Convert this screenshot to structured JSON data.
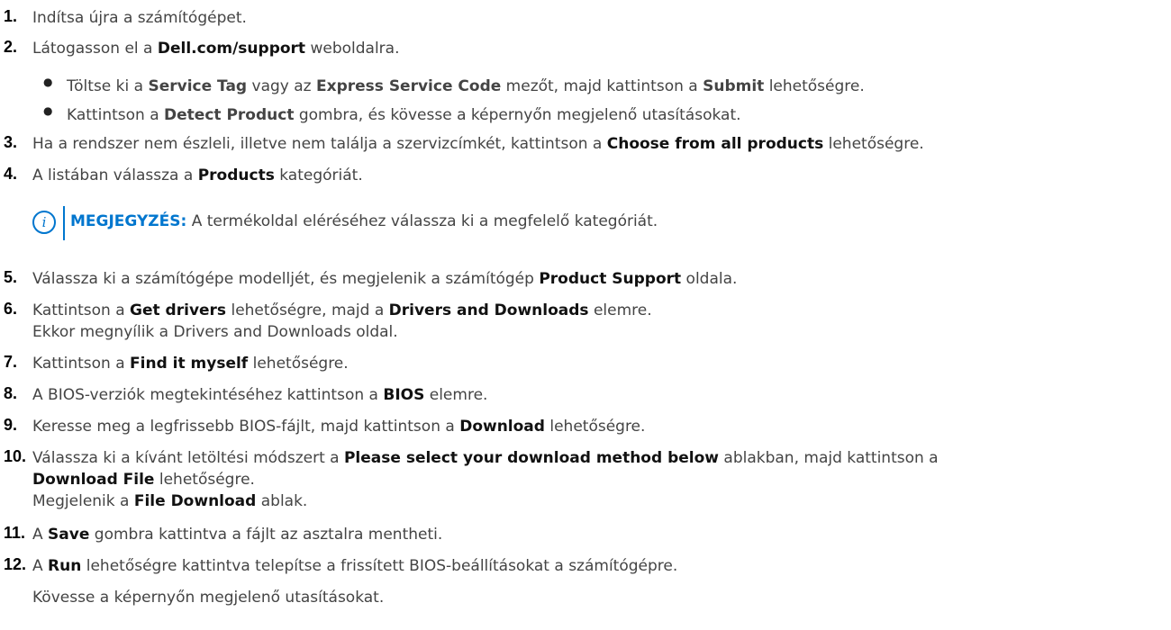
{
  "steps": [
    {
      "n": "1.",
      "parts": [
        [
          "t",
          "Indítsa újra a számítógépet."
        ]
      ]
    },
    {
      "n": "2.",
      "parts": [
        [
          "t",
          "Látogasson el a "
        ],
        [
          "b",
          "Dell.com/support"
        ],
        [
          "t",
          " weboldalra."
        ]
      ],
      "bullets": [
        [
          [
            "t",
            "Töltse ki a "
          ],
          [
            "b",
            "Service Tag"
          ],
          [
            "t",
            " vagy az "
          ],
          [
            "b",
            "Express Service Code"
          ],
          [
            "t",
            " mezőt, majd kattintson a "
          ],
          [
            "b",
            "Submit"
          ],
          [
            "t",
            " lehetőségre."
          ]
        ],
        [
          [
            "t",
            "Kattintson a "
          ],
          [
            "b",
            "Detect Product"
          ],
          [
            "t",
            " gombra, és kövesse a képernyőn megjelenő utasításokat."
          ]
        ]
      ]
    },
    {
      "n": "3.",
      "parts": [
        [
          "t",
          "Ha a rendszer nem észleli, illetve nem találja a szervizcímkét, kattintson a "
        ],
        [
          "b",
          "Choose from all products"
        ],
        [
          "t",
          " lehetőségre."
        ]
      ]
    },
    {
      "n": "4.",
      "parts": [
        [
          "t",
          "A listában válassza a "
        ],
        [
          "b",
          "Products"
        ],
        [
          "t",
          " kategóriát."
        ]
      ]
    },
    {
      "n": "5.",
      "parts": [
        [
          "t",
          "Válassza ki a számítógépe modelljét, és megjelenik a számítógép "
        ],
        [
          "b",
          "Product Support"
        ],
        [
          "t",
          " oldala."
        ]
      ]
    },
    {
      "n": "6.",
      "parts": [
        [
          "t",
          "Kattintson a "
        ],
        [
          "b",
          "Get drivers"
        ],
        [
          "t",
          " lehetőségre, majd a "
        ],
        [
          "b",
          "Drivers and Downloads"
        ],
        [
          "t",
          " elemre."
        ]
      ],
      "extra": [
        [
          [
            "t",
            "Ekkor megnyílik a Drivers and Downloads oldal."
          ]
        ]
      ]
    },
    {
      "n": "7.",
      "parts": [
        [
          "t",
          "Kattintson a "
        ],
        [
          "b",
          "Find it myself"
        ],
        [
          "t",
          " lehetőségre."
        ]
      ]
    },
    {
      "n": "8.",
      "parts": [
        [
          "t",
          "A BIOS-verziók megtekintéséhez kattintson a "
        ],
        [
          "b",
          "BIOS"
        ],
        [
          "t",
          " elemre."
        ]
      ]
    },
    {
      "n": "9.",
      "parts": [
        [
          "t",
          "Keresse meg a legfrissebb BIOS-fájlt, majd kattintson a "
        ],
        [
          "b",
          "Download"
        ],
        [
          "t",
          " lehetőségre."
        ]
      ]
    },
    {
      "n": "10.",
      "parts": [
        [
          "t",
          "Válassza ki a kívánt letöltési módszert a "
        ],
        [
          "b",
          "Please select your download method below"
        ],
        [
          "t",
          " ablakban, majd kattintson a"
        ]
      ],
      "extra": [
        [
          [
            "b",
            "Download File"
          ],
          [
            "t",
            " lehetőségre."
          ]
        ],
        [
          [
            "t",
            "Megjelenik a "
          ],
          [
            "b",
            "File Download"
          ],
          [
            "t",
            " ablak."
          ]
        ]
      ]
    },
    {
      "n": "11.",
      "parts": [
        [
          "t",
          "A "
        ],
        [
          "b",
          "Save"
        ],
        [
          "t",
          " gombra kattintva a fájlt az asztalra mentheti."
        ]
      ]
    },
    {
      "n": "12.",
      "parts": [
        [
          "t",
          "A "
        ],
        [
          "b",
          "Run"
        ],
        [
          "t",
          " lehetőségre kattintva telepítse a frissített BIOS-beállításokat a számítógépre."
        ]
      ],
      "extra": [
        [
          [
            "t",
            "Kövesse a képernyőn megjelenő utasításokat."
          ]
        ]
      ]
    }
  ],
  "note": {
    "icon": "info-icon",
    "label": "MEGJEGYZÉS:",
    "text": " A termékoldal eléréséhez válassza ki a megfelelő kategóriát."
  },
  "bullet_char": "●",
  "colors": {
    "accent": "#0076ce",
    "text": "#444444"
  }
}
